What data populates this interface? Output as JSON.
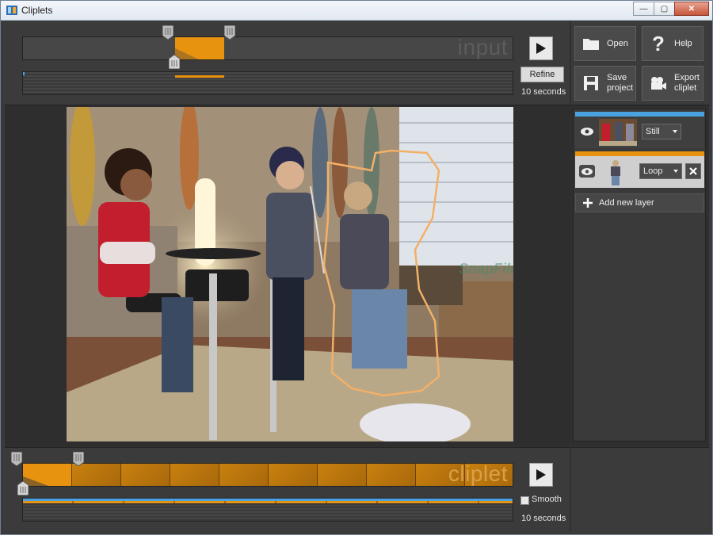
{
  "window": {
    "title": "Cliplets",
    "minimize": "—",
    "maximize": "▢",
    "close": "✕"
  },
  "input_strip": {
    "watermark": "input",
    "refine_label": "Refine",
    "duration": "10 seconds"
  },
  "commands": {
    "open": "Open",
    "help": "Help",
    "save_line1": "Save",
    "save_line2": "project",
    "export_line1": "Export",
    "export_line2": "cliplet"
  },
  "layers": [
    {
      "mode": "Still",
      "color": "#4aa3e0"
    },
    {
      "mode": "Loop",
      "color": "#e8930f"
    }
  ],
  "add_layer_label": "Add new layer",
  "cliplet_strip": {
    "watermark": "cliplet",
    "smooth_label": "Smooth",
    "smooth_checked": false,
    "duration": "10 seconds"
  },
  "video_watermark": "SnapFiles",
  "colors": {
    "accent_orange": "#e8930f",
    "accent_blue": "#4aa3e0",
    "panel": "#3b3b3b"
  },
  "icons": [
    "app-icon",
    "play-icon",
    "folder-icon",
    "question-icon",
    "save-icon",
    "camera-icon",
    "eye-icon",
    "close-icon",
    "plus-icon"
  ]
}
